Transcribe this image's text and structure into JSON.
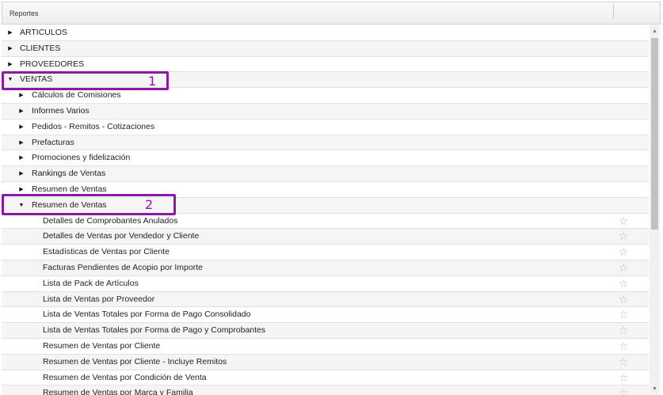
{
  "header": {
    "title": "Reportes"
  },
  "tree": {
    "top": [
      {
        "label": "ARTICULOS"
      },
      {
        "label": "CLIENTES"
      },
      {
        "label": "PROVEEDORES"
      },
      {
        "label": "VENTAS"
      }
    ],
    "ventas": [
      {
        "label": "Cálculos de Comisiones"
      },
      {
        "label": "Informes Varios"
      },
      {
        "label": "Pedidos - Remitos - Cotizaciones"
      },
      {
        "label": "Prefacturas"
      },
      {
        "label": "Promociones y fidelización"
      },
      {
        "label": "Rankings de Ventas"
      },
      {
        "label": "Resumen de Ventas"
      },
      {
        "label": "Resumen de Ventas"
      }
    ],
    "reports": [
      {
        "label": "Detalles de Comprobantes Anulados"
      },
      {
        "label": "Detalles de Ventas por Vendedor y Cliente"
      },
      {
        "label": "Estadísticas de Ventas por Cliente"
      },
      {
        "label": "Facturas Pendientes de Acopio por Importe"
      },
      {
        "label": "Lista de Pack de Artículos"
      },
      {
        "label": "Lista de Ventas por Proveedor"
      },
      {
        "label": "Lista de Ventas Totales por Forma de Pago Consolidado"
      },
      {
        "label": "Lista de Ventas Totales por Forma de Pago y Comprobantes"
      },
      {
        "label": "Resumen de Ventas por Cliente"
      },
      {
        "label": "Resumen de Ventas por Cliente - Incluye Remitos"
      },
      {
        "label": "Resumen de Ventas por Condición de Venta"
      },
      {
        "label": "Resumen de Ventas por Marca y Familia"
      }
    ]
  },
  "callouts": {
    "first": "1",
    "second": "2"
  },
  "icons": {
    "collapsed": "caret-right-icon",
    "expanded": "caret-down-icon",
    "favorite": "star-outline-icon"
  },
  "colors": {
    "callout": "#8b1aa3",
    "row_alt": "#f5f5f5"
  }
}
